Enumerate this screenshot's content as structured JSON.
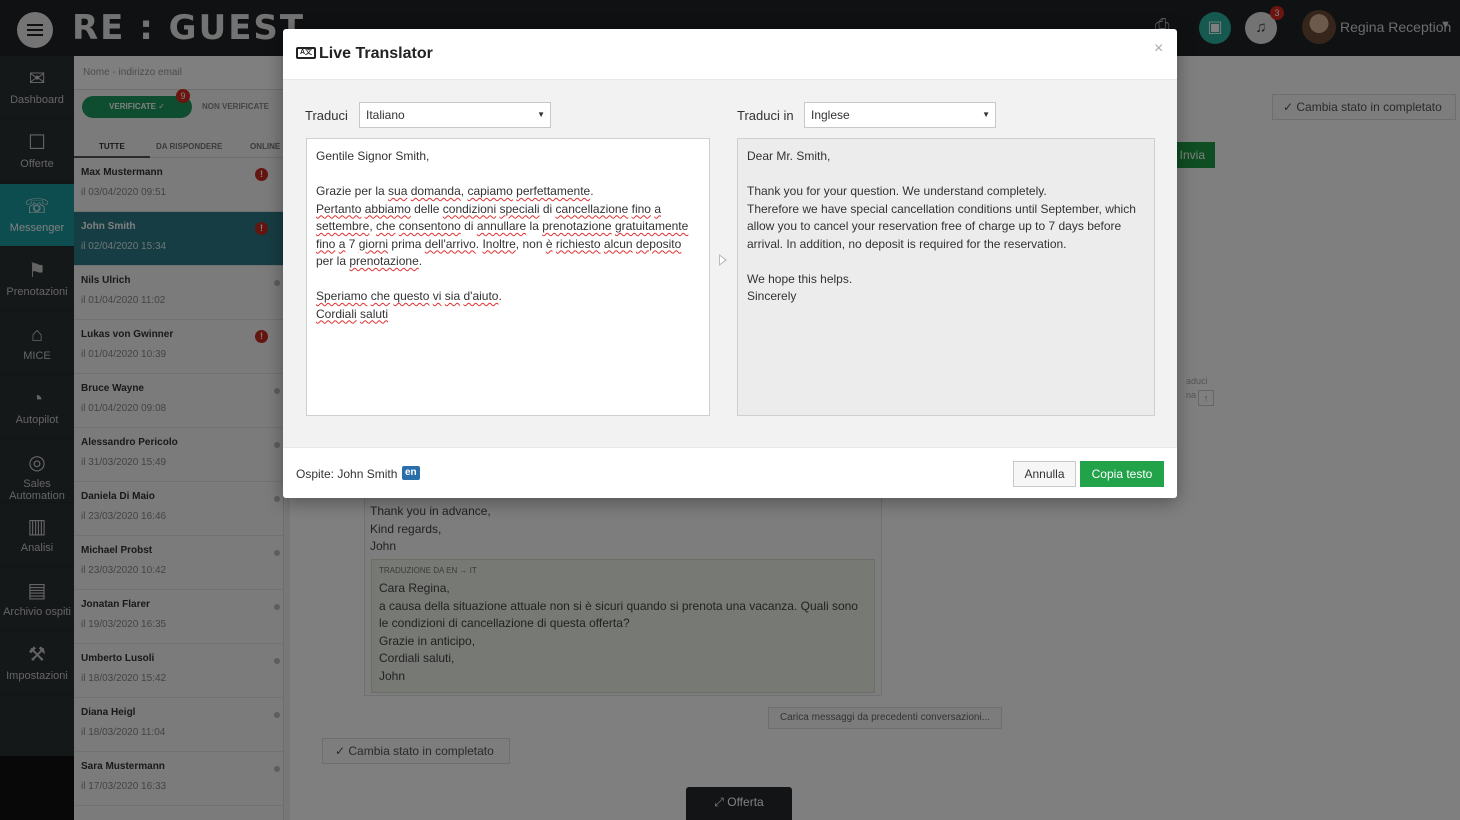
{
  "topbar": {
    "logo": "RE : GUEST",
    "notification_count": "3",
    "user_name": "Regina Reception"
  },
  "nav": {
    "items": [
      {
        "label": "Dashboard",
        "icon": "inbox-icon"
      },
      {
        "label": "Offerte",
        "icon": "offers-icon"
      },
      {
        "label": "Messenger",
        "icon": "chat-icon"
      },
      {
        "label": "Prenotazioni",
        "icon": "flag-icon"
      },
      {
        "label": "MICE",
        "icon": "building-icon"
      },
      {
        "label": "Autopilot",
        "icon": "gauge-icon"
      },
      {
        "label": "Sales Automation",
        "icon": "target-icon"
      },
      {
        "label": "Analisi",
        "icon": "bar-chart-icon"
      },
      {
        "label": "Archivio ospiti",
        "icon": "briefcase-icon"
      },
      {
        "label": "Impostazioni",
        "icon": "wrench-icon"
      }
    ]
  },
  "conversations": {
    "search_placeholder": "Nome - indirizzo email",
    "filter_verified": "VERIFICATE",
    "filter_verified_count": "9",
    "filter_unverified": "NON VERIFICATE",
    "tabs": [
      "TUTTE",
      "DA RISPONDERE",
      "ONLINE"
    ],
    "items": [
      {
        "name": "Max Mustermann",
        "date": "il 03/04/2020 09:51",
        "unread": "!"
      },
      {
        "name": "John Smith",
        "date": "il 02/04/2020 15:34",
        "unread": "!"
      },
      {
        "name": "Nils Ulrich",
        "date": "il 01/04/2020 11:02",
        "unread": ""
      },
      {
        "name": "Lukas von Gwinner",
        "date": "il 01/04/2020 10:39",
        "unread": "!"
      },
      {
        "name": "Bruce Wayne",
        "date": "il 01/04/2020 09:08",
        "unread": ""
      },
      {
        "name": "Alessandro Pericolo",
        "date": "il 31/03/2020 15:49",
        "unread": ""
      },
      {
        "name": "Daniela Di Maio",
        "date": "il 23/03/2020 16:46",
        "unread": ""
      },
      {
        "name": "Michael Probst",
        "date": "il 23/03/2020 10:42",
        "unread": ""
      },
      {
        "name": "Jonatan Flarer",
        "date": "il 19/03/2020 16:35",
        "unread": ""
      },
      {
        "name": "Umberto Lusoli",
        "date": "il 18/03/2020 15:42",
        "unread": ""
      },
      {
        "name": "Diana Heigl",
        "date": "il 18/03/2020 11:04",
        "unread": ""
      },
      {
        "name": "Sara Mustermann",
        "date": "il 17/03/2020 16:33",
        "unread": ""
      }
    ]
  },
  "main": {
    "status_button": "Cambia stato in completato",
    "send_button": "Invia",
    "message_tail": "Thank you in advance,\nKind regards,\nJohn",
    "translation_header": "TRADUZIONE DA EN → IT",
    "translation_text": "Cara Regina,\na causa della situazione attuale non si è sicuri quando si prenota una vacanza. Quali sono\nle condizioni di cancellazione di questa offerta?\nGrazie in anticipo,\nCordiali saluti,\nJohn",
    "load_more": "Carica messaggi da precedenti conversazioni...",
    "offer_button": "Offerta",
    "side_text_1": "aduci",
    "side_text_2": "na"
  },
  "modal": {
    "title": "Live Translator",
    "source_label": "Traduci",
    "source_language": "Italiano",
    "target_label": "Traduci in",
    "target_language": "Inglese",
    "target_text": "Dear Mr. Smith,\n\nThank you for your question. We understand completely.\nTherefore we have special cancellation conditions until September, which\nallow you to cancel your reservation free of charge up to 7 days before\narrival. In addition, no deposit is required for the reservation.\n\nWe hope this helps.\nSincerely",
    "guest_label": "Ospite: John Smith",
    "guest_language": "en",
    "cancel_button": "Annulla",
    "copy_button": "Copia testo"
  },
  "colors": {
    "accent_teal": "#1a9aa0",
    "primary_green": "#22a34a",
    "alert_red": "#d9281e",
    "language_blue": "#2a6faa"
  }
}
